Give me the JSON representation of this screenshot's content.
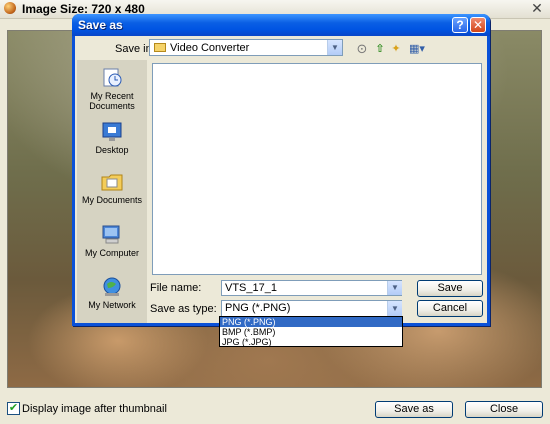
{
  "window": {
    "title": "Image Size: 720 x 480",
    "close_glyph": "✕"
  },
  "bottom_bar": {
    "checkbox_checked": true,
    "checkbox_label": "Display image after thumbnail",
    "save_as_label": "Save as",
    "close_label": "Close"
  },
  "dialog": {
    "title": "Save as",
    "help_glyph": "?",
    "close_glyph": "✕",
    "save_in_label": "Save in:",
    "save_in_value": "Video Converter",
    "toolbar_icons": [
      "back-icon",
      "up-folder-icon",
      "new-folder-icon",
      "views-menu-icon"
    ],
    "places": [
      {
        "name": "recent-documents",
        "label": "My Recent Documents"
      },
      {
        "name": "desktop",
        "label": "Desktop"
      },
      {
        "name": "my-documents",
        "label": "My Documents"
      },
      {
        "name": "my-computer",
        "label": "My Computer"
      },
      {
        "name": "my-network",
        "label": "My Network"
      }
    ],
    "file_name_label": "File name:",
    "file_name_value": "VTS_17_1",
    "save_as_type_label": "Save as type:",
    "save_as_type_value": "PNG (*.PNG)",
    "save_button": "Save",
    "cancel_button": "Cancel",
    "type_options": [
      "PNG (*.PNG)",
      "BMP (*.BMP)",
      "JPG (*.JPG)"
    ],
    "selected_type_index": 0
  },
  "colors": {
    "title_blue": "#0054e3",
    "selection": "#316ac5",
    "face": "#ece9d8"
  }
}
